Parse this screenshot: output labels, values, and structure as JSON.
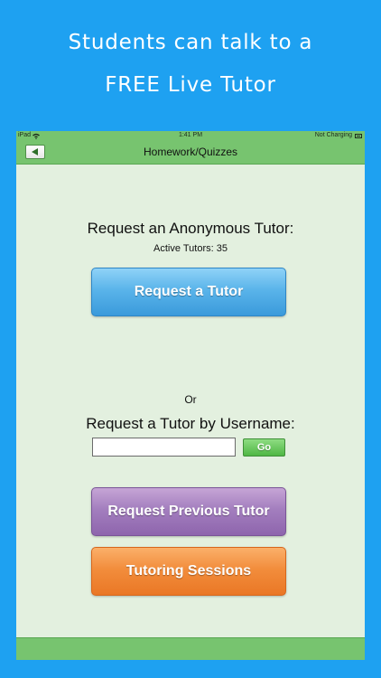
{
  "promo": {
    "line1": "Students can talk to a",
    "line2": "FREE Live Tutor"
  },
  "statusbar": {
    "carrier": "iPad",
    "time": "1:41 PM",
    "battery_text": "Not Charging"
  },
  "navbar": {
    "title": "Homework/Quizzes",
    "back_icon": "back-arrow-icon"
  },
  "anonymous": {
    "title": "Request an Anonymous Tutor:",
    "active_tutors": "Active Tutors: 35",
    "button_label": "Request a Tutor"
  },
  "or_text": "Or",
  "username": {
    "title": "Request a Tutor by Username:",
    "input_value": "",
    "placeholder": "",
    "go_label": "Go"
  },
  "actions": {
    "previous_tutor_label": "Request Previous Tutor",
    "sessions_label": "Tutoring Sessions"
  },
  "colors": {
    "background": "#1ea1f1",
    "bar_green": "#77c46f",
    "content_bg": "#e3f0df",
    "blue_button": "#5ab4ea",
    "purple_button": "#a37ebe",
    "orange_button": "#f28d3c",
    "go_button": "#4fb744"
  }
}
